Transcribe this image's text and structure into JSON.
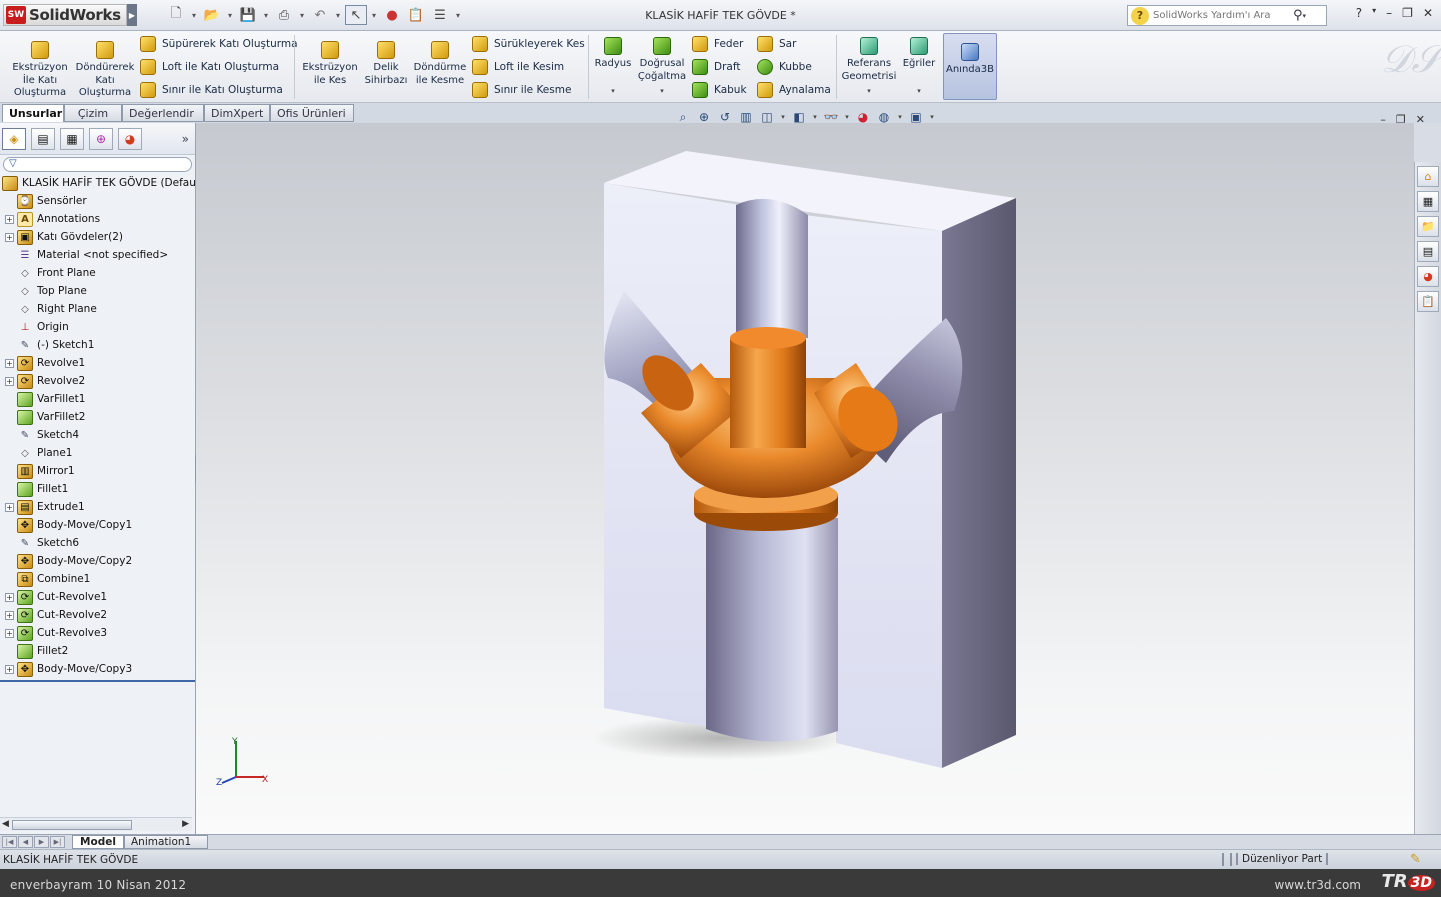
{
  "titlebar": {
    "app_logo_badge": "SW",
    "app_name": "SolidWorks",
    "window_title": "KLASİK HAFİF TEK GÖVDE *",
    "help_search_placeholder": "SolidWorks Yardım'ı Ara"
  },
  "ribbon": {
    "extrude_boss": "Ekstrüzyon İle Katı Oluşturma",
    "revolve_boss": "Döndürerek Katı Oluşturma",
    "sweep_boss": "Süpürerek Katı Oluşturma",
    "loft_boss": "Loft ile Katı Oluşturma",
    "boundary_boss": "Sınır ile Katı Oluşturma",
    "extrude_cut": "Ekstrüzyon ile Kes",
    "hole_wizard": "Delik Sihirbazı",
    "revolve_cut": "Döndürme ile Kesme",
    "sweep_cut": "Sürükleyerek Kes",
    "loft_cut": "Loft ile Kesim",
    "boundary_cut": "Sınır ile Kesme",
    "fillet": "Radyus",
    "linear_pattern": "Doğrusal Çoğaltma",
    "rib": "Feder",
    "draft": "Draft",
    "shell": "Kabuk",
    "wrap": "Sar",
    "dome": "Kubbe",
    "mirror": "Aynalama",
    "ref_geometry": "Referans Geometrisi",
    "curves": "Eğriler",
    "instant3d": "Anında3B"
  },
  "tabs": [
    "Unsurlar",
    "Çizim",
    "Değerlendir",
    "DimXpert",
    "Ofis Ürünleri"
  ],
  "feature_tree": {
    "root": "KLASİK HAFİF TEK GÖVDE  (Default",
    "items": [
      {
        "label": "Sensörler",
        "icon": "sensor-icon",
        "expandable": false
      },
      {
        "label": "Annotations",
        "icon": "annotations-icon",
        "expandable": true
      },
      {
        "label": "Katı Gövdeler(2)",
        "icon": "solid-bodies-icon",
        "expandable": true
      },
      {
        "label": "Material <not specified>",
        "icon": "material-icon",
        "expandable": false
      },
      {
        "label": "Front Plane",
        "icon": "plane-icon",
        "expandable": false
      },
      {
        "label": "Top Plane",
        "icon": "plane-icon",
        "expandable": false
      },
      {
        "label": "Right Plane",
        "icon": "plane-icon",
        "expandable": false
      },
      {
        "label": "Origin",
        "icon": "origin-icon",
        "expandable": false
      },
      {
        "label": "(-) Sketch1",
        "icon": "sketch-icon",
        "expandable": false
      },
      {
        "label": "Revolve1",
        "icon": "revolve-icon",
        "expandable": true
      },
      {
        "label": "Revolve2",
        "icon": "revolve-icon",
        "expandable": true
      },
      {
        "label": "VarFillet1",
        "icon": "fillet-icon",
        "expandable": false
      },
      {
        "label": "VarFillet2",
        "icon": "fillet-icon",
        "expandable": false
      },
      {
        "label": "Sketch4",
        "icon": "sketch-icon",
        "expandable": false
      },
      {
        "label": "Plane1",
        "icon": "plane-icon",
        "expandable": false
      },
      {
        "label": "Mirror1",
        "icon": "mirror-icon",
        "expandable": false
      },
      {
        "label": "Fillet1",
        "icon": "fillet-icon",
        "expandable": false
      },
      {
        "label": "Extrude1",
        "icon": "extrude-icon",
        "expandable": true
      },
      {
        "label": "Body-Move/Copy1",
        "icon": "move-copy-icon",
        "expandable": false
      },
      {
        "label": "Sketch6",
        "icon": "sketch-icon",
        "expandable": false
      },
      {
        "label": "Body-Move/Copy2",
        "icon": "move-copy-icon",
        "expandable": false
      },
      {
        "label": "Combine1",
        "icon": "combine-icon",
        "expandable": false
      },
      {
        "label": "Cut-Revolve1",
        "icon": "cut-revolve-icon",
        "expandable": true
      },
      {
        "label": "Cut-Revolve2",
        "icon": "cut-revolve-icon",
        "expandable": true
      },
      {
        "label": "Cut-Revolve3",
        "icon": "cut-revolve-icon",
        "expandable": true
      },
      {
        "label": "Fillet2",
        "icon": "fillet-icon",
        "expandable": false
      },
      {
        "label": "Body-Move/Copy3",
        "icon": "move-copy-icon",
        "expandable": true
      }
    ]
  },
  "triad": {
    "x": "X",
    "y": "Y",
    "z": "Z"
  },
  "bottom_tabs": [
    "Model",
    "Animation1"
  ],
  "status": {
    "doc_name": "KLASİK HAFİF TEK GÖVDE",
    "mode": "Düzenliyor Part"
  },
  "footer": {
    "credit": "enverbayram 10 Nisan 2012",
    "site": "www.tr3d.com",
    "logo_tr": "TR",
    "logo_3d": "3D"
  },
  "colors": {
    "part_body": "#e2e3f0",
    "part_side": "#66647c",
    "copper": "#e0801f",
    "accent_blue": "#4068a8"
  }
}
